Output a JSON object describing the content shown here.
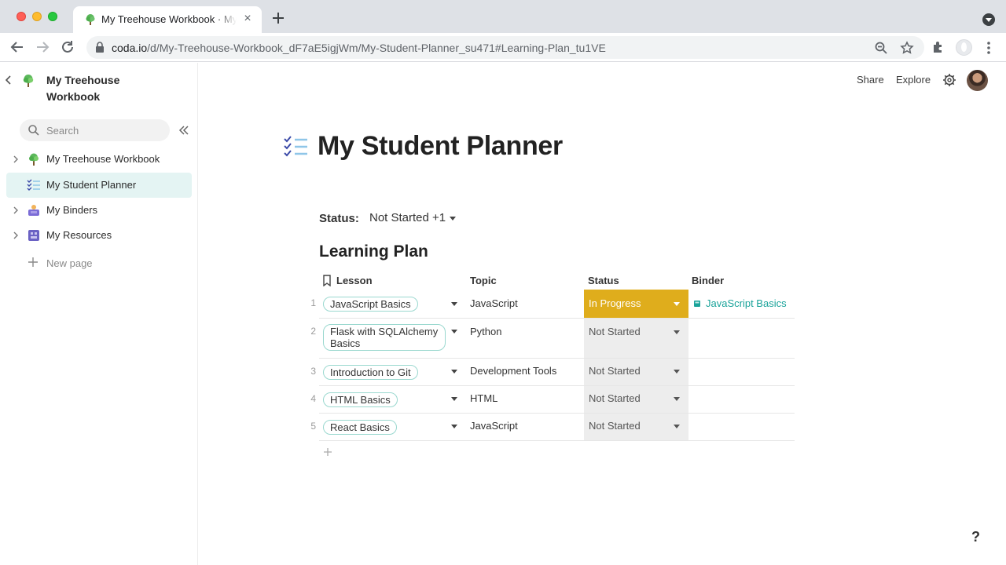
{
  "browser": {
    "tab_title": "My Treehouse Workbook · My Student Planner",
    "url_host": "coda.io",
    "url_path": "/d/My-Treehouse-Workbook_dF7aE5igjWm/My-Student-Planner_su471#Learning-Plan_tu1VE"
  },
  "sidebar": {
    "doc_title": "My Treehouse Workbook",
    "search_placeholder": "Search",
    "items": [
      {
        "label": "My Treehouse Workbook",
        "icon": "tree-icon",
        "active": false
      },
      {
        "label": "My Student Planner",
        "icon": "checklist-icon",
        "active": true
      },
      {
        "label": "My Binders",
        "icon": "binder-icon",
        "active": false
      },
      {
        "label": "My Resources",
        "icon": "resources-icon",
        "active": false
      }
    ],
    "new_page_label": "New page"
  },
  "header": {
    "share_label": "Share",
    "explore_label": "Explore"
  },
  "page": {
    "title": "My Student Planner",
    "filter_label": "Status:",
    "filter_value": "Not Started +1",
    "section_title": "Learning Plan"
  },
  "table": {
    "columns": [
      "Lesson",
      "Topic",
      "Status",
      "Binder"
    ],
    "rows": [
      {
        "num": "1",
        "lesson": "JavaScript Basics",
        "topic": "JavaScript",
        "status": "In Progress",
        "binder": "JavaScript Basics"
      },
      {
        "num": "2",
        "lesson": "Flask with SQLAlchemy Basics",
        "topic": "Python",
        "status": "Not Started",
        "binder": ""
      },
      {
        "num": "3",
        "lesson": "Introduction to Git",
        "topic": "Development Tools",
        "status": "Not Started",
        "binder": ""
      },
      {
        "num": "4",
        "lesson": "HTML Basics",
        "topic": "HTML",
        "status": "Not Started",
        "binder": ""
      },
      {
        "num": "5",
        "lesson": "React Basics",
        "topic": "JavaScript",
        "status": "Not Started",
        "binder": ""
      }
    ]
  },
  "help_label": "?",
  "colors": {
    "accent_teal": "#1aa39a",
    "in_progress": "#dfad1c",
    "not_started": "#ededed",
    "active_nav": "#e4f4f3"
  }
}
